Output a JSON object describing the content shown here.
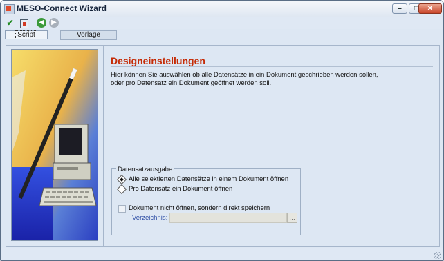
{
  "window": {
    "title": "MESO-Connect Wizard",
    "controls": {
      "minimize": "–",
      "maximize": "□",
      "close": "✕"
    }
  },
  "toolbar": {
    "icons": [
      "check-icon",
      "exit-icon",
      "back-arrow-icon",
      "forward-arrow-icon"
    ],
    "accept_glyph": "✔",
    "back_glyph": "◀",
    "forward_glyph": "▶"
  },
  "tabs": [
    {
      "label": "Script",
      "active": true
    },
    {
      "label": "Vorlage",
      "active": false
    }
  ],
  "page": {
    "title": "Designeinstellungen",
    "description_line1": "Hier können Sie auswählen ob alle Datensätze in ein Dokument geschrieben werden sollen,",
    "description_line2": "oder pro Datensatz ein Dokument geöffnet werden soll."
  },
  "output_group": {
    "title": "Datensatzausgabe",
    "options": [
      {
        "label": "Alle selektierten Datensätze in einem Dokument öffnen",
        "selected": true
      },
      {
        "label": "Pro Datensatz ein Dokument öffnen",
        "selected": false
      }
    ],
    "save_checkbox": {
      "label": "Dokument nicht öffnen, sondern direkt speichern",
      "checked": false
    },
    "directory": {
      "label": "Verzeichnis:",
      "value": "",
      "browse_glyph": "…"
    }
  },
  "colors": {
    "title_accent": "#c52b06",
    "window_bg": "#dde7f3",
    "link_label": "#2f4fa5"
  }
}
